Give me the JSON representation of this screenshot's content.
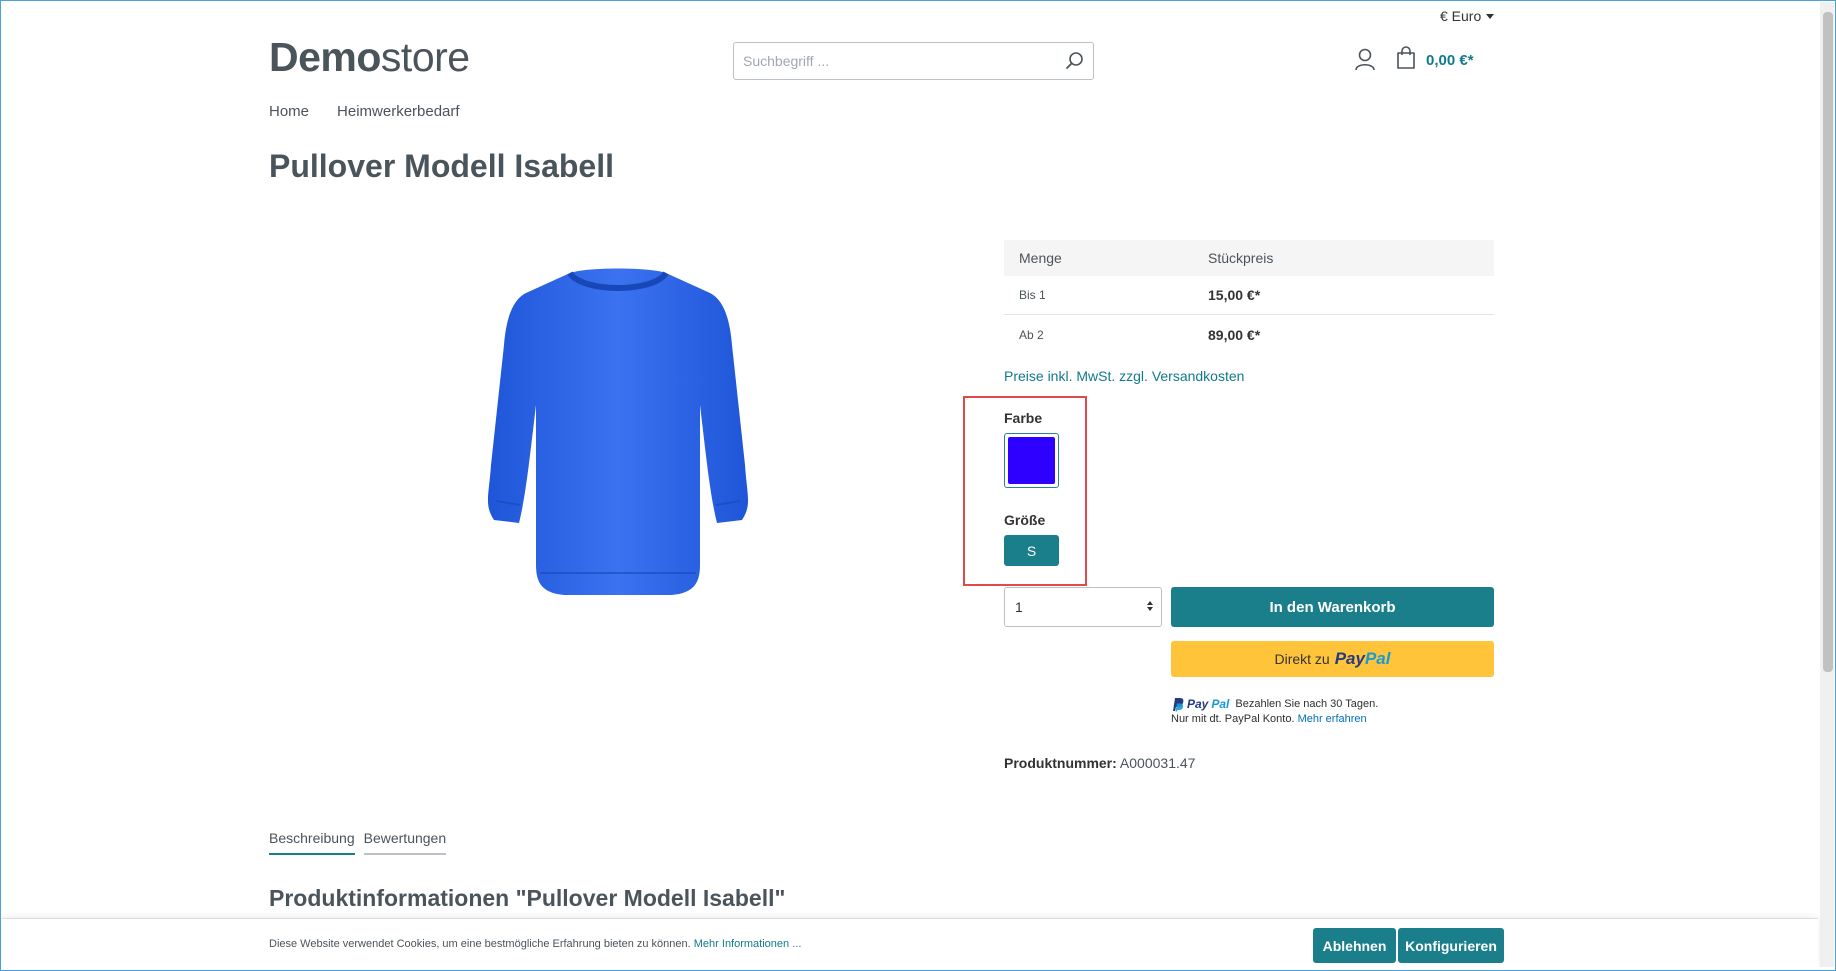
{
  "header": {
    "currency": "€ Euro",
    "logo_bold": "Demo",
    "logo_light": "store",
    "search_placeholder": "Suchbegriff ...",
    "cart_total": "0,00 €*"
  },
  "nav": {
    "items": [
      "Home",
      "Heimwerkerbedarf"
    ]
  },
  "product": {
    "title": "Pullover Modell Isabell",
    "price_table": {
      "headers": [
        "Menge",
        "Stückpreis"
      ],
      "rows": [
        {
          "qty": "Bis 1",
          "price": "15,00 €*"
        },
        {
          "qty": "Ab 2",
          "price": "89,00 €*"
        }
      ]
    },
    "tax_link": "Preise inkl. MwSt. zzgl. Versandkosten",
    "color_label": "Farbe",
    "color_value": "#2e00ff",
    "size_label": "Größe",
    "size_value": "S",
    "quantity": "1",
    "add_to_cart": "In den Warenkorb",
    "paypal_prefix": "Direkt zu",
    "paypal_brand_1": "Pay",
    "paypal_brand_2": "Pal",
    "paypal_msg_line1": "Bezahlen Sie nach 30 Tagen.",
    "paypal_msg_line2": "Nur mit dt. PayPal Konto.",
    "paypal_msg_more": "Mehr erfahren",
    "product_number_label": "Produktnummer:",
    "product_number": "A000031.47"
  },
  "tabs": [
    "Beschreibung",
    "Bewertungen"
  ],
  "section_title": "Produktinformationen \"Pullover Modell Isabell\"",
  "cookie": {
    "text": "Diese Website verwendet Cookies, um eine bestmögliche Erfahrung bieten zu können.",
    "more_link": "Mehr Informationen ...",
    "decline": "Ablehnen",
    "configure": "Konfigurieren"
  },
  "colors": {
    "accent": "#1a7f8b",
    "link": "#107a8c",
    "paypal_yellow": "#ffc439",
    "highlight_border": "#e04a4a"
  }
}
